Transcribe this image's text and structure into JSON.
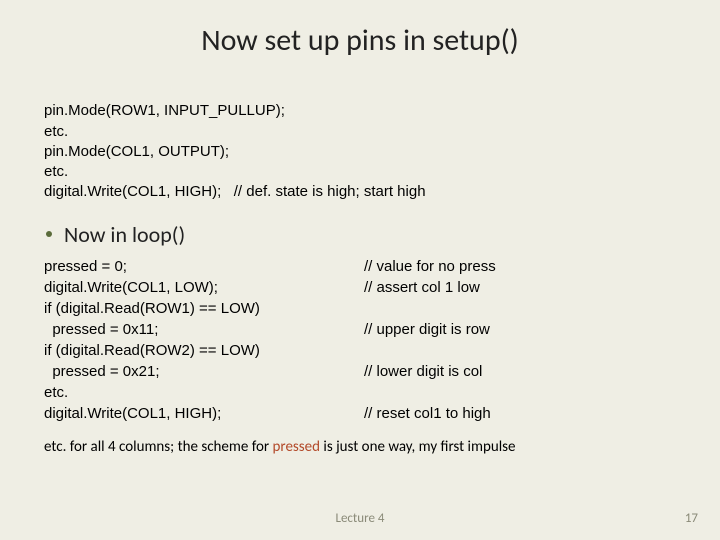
{
  "title": "Now set up pins in setup()",
  "code_top": {
    "l1": "pin.Mode(ROW1, INPUT_PULLUP);",
    "l2": "etc.",
    "l3": "pin.Mode(COL1, OUTPUT);",
    "l4": "etc.",
    "l5": "digital.Write(COL1, HIGH);   // def. state is high; start high"
  },
  "bullet": "Now in loop()",
  "loop": {
    "r0l": "pressed = 0;",
    "r0r": "// value for no press",
    "r1l": "",
    "r1r": "",
    "r2l": "digital.Write(COL1, LOW);",
    "r2r": "// assert col 1 low",
    "r3l": "if (digital.Read(ROW1) == LOW)",
    "r3r": "",
    "r4l": "  pressed = 0x11;",
    "r4r": "// upper digit is row",
    "r5l": "if (digital.Read(ROW2) == LOW)",
    "r5r": "",
    "r6l": "  pressed = 0x21;",
    "r6r": "// lower digit is col",
    "r7l": "etc.",
    "r7r": "",
    "r8l": "digital.Write(COL1, HIGH);",
    "r8r": "// reset col1 to high"
  },
  "footnote": {
    "pre": "etc. for all 4 columns; the scheme for ",
    "kw": "pressed",
    "post": " is just one way, my first impulse"
  },
  "footer": {
    "center": "Lecture 4",
    "right": "17"
  }
}
